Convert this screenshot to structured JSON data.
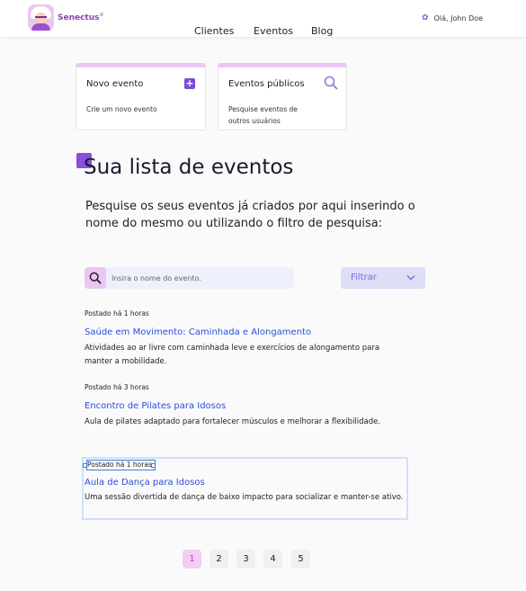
{
  "header": {
    "brand": "Senectus",
    "brand_mark": "®",
    "nav": [
      "Clientes",
      "Eventos",
      "Blog"
    ],
    "greeting": "Olá, John Doe"
  },
  "cards": {
    "new_event": {
      "title": "Novo evento",
      "description": "Crie um novo evento"
    },
    "public_events": {
      "title": "Eventos públicos",
      "description": "Pesquise  eventos de outros usuários"
    }
  },
  "main": {
    "heading": "Sua lista de eventos",
    "subtitle": "Pesquise os seus eventos já criados por aqui inserindo o nome do mesmo ou utilizando o filtro de pesquisa:",
    "search_placeholder": "Insira o nome do evento.",
    "filter_label": "Filtrar"
  },
  "events": [
    {
      "posted": "Postado há 1 horas",
      "title": "Saúde em Movimento: Caminhada e Alongamento",
      "description": "Atividades ao ar livre com caminhada leve e exercícios de alongamento para manter a mobilidade."
    },
    {
      "posted": "Postado há 3 horas",
      "title": "Encontro de Pilates para Idosos",
      "description": "Aula de pilates adaptado para fortalecer músculos e melhorar a flexibilidade."
    },
    {
      "posted": "Postado há 1 horas",
      "title": "Aula de Dança para Idosos",
      "description": "Uma sessão divertida de dança de baixo impacto para socializar e manter-se ativo."
    }
  ],
  "pagination": {
    "pages": [
      "1",
      "2",
      "3",
      "4",
      "5"
    ],
    "current": "1"
  },
  "colors": {
    "accent": "#8a4fd8",
    "link": "#2a4fd6",
    "card_top": "#eac7f4"
  },
  "icons": {
    "settings": "gear-icon",
    "add": "plus-icon",
    "search": "search-icon",
    "filter": "chevron-down-icon"
  }
}
